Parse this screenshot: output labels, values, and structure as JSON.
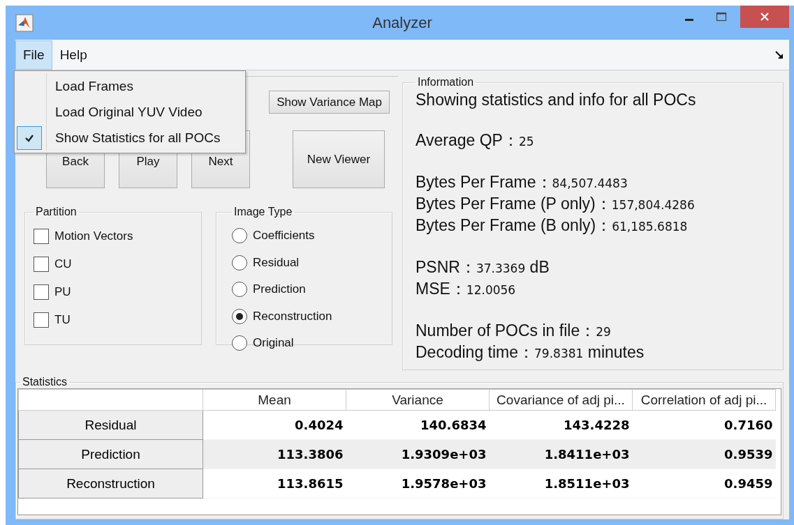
{
  "window": {
    "title": "Analyzer"
  },
  "menu_bar": [
    {
      "label": "File",
      "selected": true
    },
    {
      "label": "Help",
      "selected": false
    }
  ],
  "file_menu": [
    {
      "label": "Load Frames",
      "checked": false
    },
    {
      "label": "Load Original YUV Video",
      "checked": false
    },
    {
      "label": "Show Statistics for all POCs",
      "checked": true
    }
  ],
  "controls": {
    "variance_button": "Show Variance Map",
    "nav_buttons": [
      "Back",
      "Play",
      "Next"
    ],
    "viewer_button": "New Viewer"
  },
  "partition": {
    "title": "Partition",
    "options": [
      {
        "label": "Motion Vectors",
        "checked": false
      },
      {
        "label": "CU",
        "checked": false
      },
      {
        "label": "PU",
        "checked": false
      },
      {
        "label": "TU",
        "checked": false
      }
    ]
  },
  "image_type": {
    "title": "Image Type",
    "options": [
      {
        "label": "Coefficients",
        "selected": false
      },
      {
        "label": "Residual",
        "selected": false
      },
      {
        "label": "Prediction",
        "selected": false
      },
      {
        "label": "Reconstruction",
        "selected": true
      },
      {
        "label": "Original",
        "selected": false
      }
    ]
  },
  "information": {
    "title": "Information",
    "groups": [
      [
        {
          "label": "Showing statistics and info for all POCs"
        }
      ],
      [
        {
          "label": "Average QP：",
          "value": "25"
        }
      ],
      [
        {
          "label": "Bytes Per Frame：",
          "value": "84,507.4483"
        },
        {
          "label": "Bytes Per Frame (P only)：",
          "value": "157,804.4286"
        },
        {
          "label": "Bytes Per Frame (B only)：",
          "value": "61,185.6818"
        }
      ],
      [
        {
          "label": "PSNR：",
          "value": "37.3369",
          "unit": " dB"
        },
        {
          "label": "MSE：",
          "value": "12.0056"
        }
      ],
      [
        {
          "label": "Number of POCs in file：",
          "value": "29"
        },
        {
          "label": "Decoding time：",
          "value": "79.8381",
          "unit": " minutes"
        }
      ]
    ]
  },
  "statistics": {
    "title": "Statistics",
    "columns": [
      "Mean",
      "Variance",
      "Covariance of adj pi...",
      "Correlation of adj pi..."
    ],
    "rows": [
      {
        "name": "Residual",
        "cells": [
          "0.4024",
          "140.6834",
          "143.4228",
          "0.7160"
        ]
      },
      {
        "name": "Prediction",
        "cells": [
          "113.3806",
          "1.9309e+03",
          "1.8411e+03",
          "0.9539"
        ]
      },
      {
        "name": "Reconstruction",
        "cells": [
          "113.8615",
          "1.9578e+03",
          "1.8511e+03",
          "0.9459"
        ]
      }
    ]
  }
}
